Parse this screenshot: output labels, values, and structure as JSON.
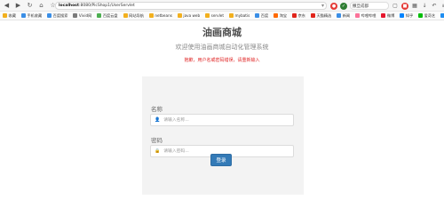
{
  "browser": {
    "url_host": "localhost",
    "url_path": ":8080/PicShop1/UserServlet",
    "extension_search": "撒旦成都",
    "nav_icons": [
      "back-icon",
      "forward-icon",
      "reload-icon",
      "home-icon",
      "star-icon"
    ]
  },
  "bookmarks": [
    {
      "label": "收藏",
      "color": "#f2b01e"
    },
    {
      "label": "手机收藏",
      "color": "#3a8ee6"
    },
    {
      "label": "百度搜索",
      "color": "#3a8ee6"
    },
    {
      "label": "Vivid网",
      "color": "#7b7b7b"
    },
    {
      "label": "百度云盘",
      "color": "#4caf50"
    },
    {
      "label": "网站导航",
      "color": "#f2b01e"
    },
    {
      "label": "netbeans",
      "color": "#f2b01e"
    },
    {
      "label": "java web",
      "color": "#f2b01e"
    },
    {
      "label": "servlet",
      "color": "#f2b01e"
    },
    {
      "label": "mybatis",
      "color": "#f2b01e"
    },
    {
      "label": "百度",
      "color": "#3a8ee6"
    },
    {
      "label": "淘宝",
      "color": "#ff6a00"
    },
    {
      "label": "京东",
      "color": "#e1251b"
    },
    {
      "label": "天猫精选",
      "color": "#e1251b"
    },
    {
      "label": "新闻",
      "color": "#3a8ee6"
    },
    {
      "label": "哔哩哔哩",
      "color": "#fb7299"
    },
    {
      "label": "微博",
      "color": "#e6162d"
    },
    {
      "label": "知乎",
      "color": "#0084ff"
    },
    {
      "label": "爱奇艺",
      "color": "#00be06"
    },
    {
      "label": "优酷",
      "color": "#1f8ef1"
    },
    {
      "label": "腾讯视频",
      "color": "#ff8a00"
    }
  ],
  "page": {
    "title": "油画商城",
    "subtitle": "欢迎使用油画商城自动化管理系统",
    "error": "抱歉，用户名或密码错误，请重新输入",
    "name_label": "名称",
    "name_placeholder": "请输入名称...",
    "password_label": "密码",
    "password_placeholder": "请输入密码...",
    "login_button": "登录"
  }
}
